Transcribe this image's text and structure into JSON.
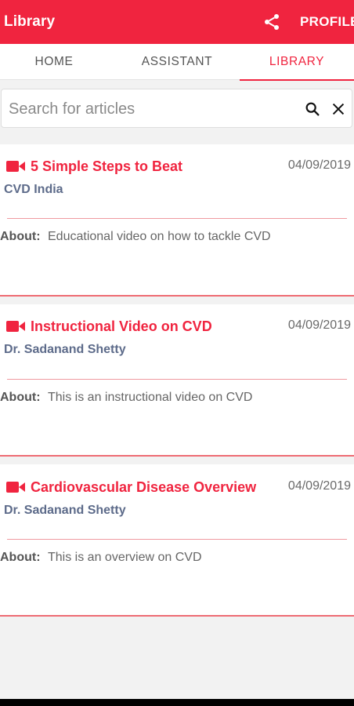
{
  "appbar": {
    "title": "Library",
    "share_icon": "share-icon",
    "profile_label": "PROFILE"
  },
  "tabs": [
    {
      "label": "HOME",
      "active": false
    },
    {
      "label": "ASSISTANT",
      "active": false
    },
    {
      "label": "LIBRARY",
      "active": true
    }
  ],
  "search": {
    "placeholder": "Search for articles",
    "value": "",
    "search_icon": "search-icon",
    "clear_icon": "close-icon"
  },
  "articles": [
    {
      "type_icon": "video-camera-icon",
      "title": "5 Simple Steps to Beat",
      "date": "04/09/2019",
      "author": "CVD India",
      "about_label": "About:",
      "about": "Educational video on how to tackle CVD"
    },
    {
      "type_icon": "video-camera-icon",
      "title": "Instructional Video on CVD",
      "date": "04/09/2019",
      "author": "Dr. Sadanand Shetty",
      "about_label": "About:",
      "about": "This is an instructional video on CVD"
    },
    {
      "type_icon": "video-camera-icon",
      "title": "Cardiovascular Disease Overview",
      "date": "04/09/2019",
      "author": "Dr. Sadanand Shetty",
      "about_label": "About:",
      "about": "This is an overview on CVD"
    }
  ],
  "colors": {
    "primary": "#f0243f",
    "author": "#5d6b8a",
    "divider": "#ef9aa0",
    "background": "#f2f2f2"
  }
}
